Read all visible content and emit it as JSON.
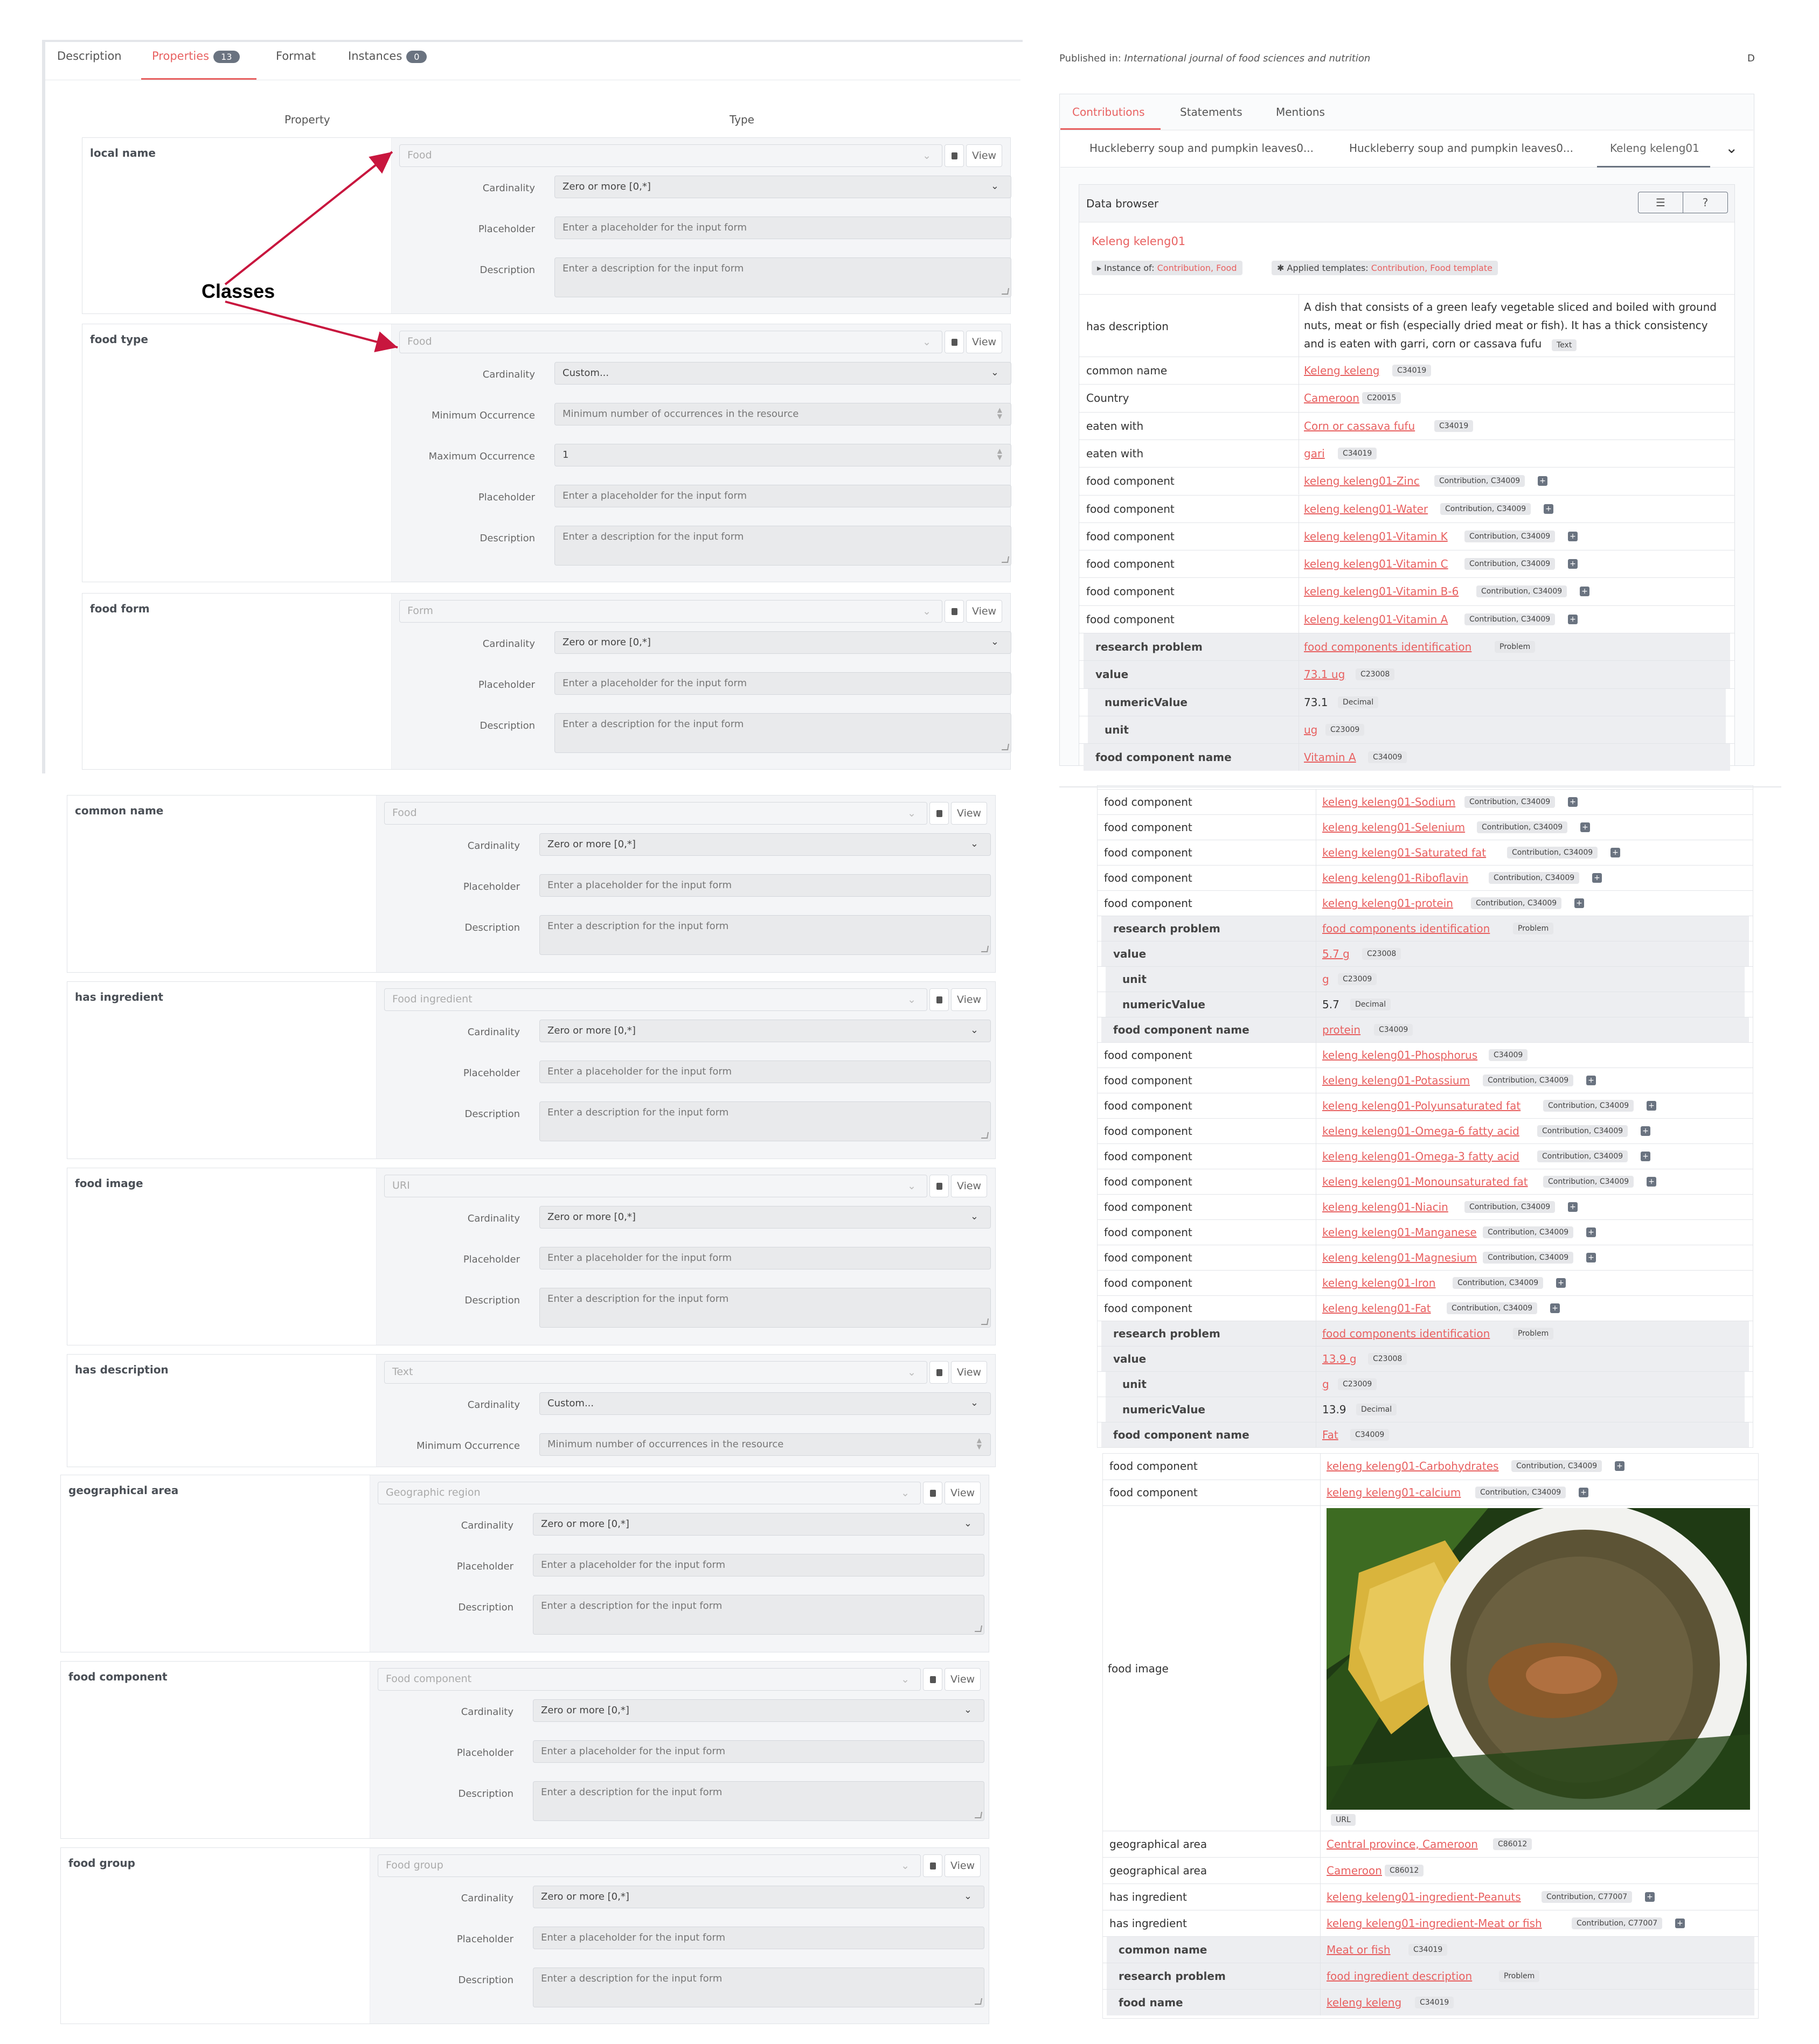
{
  "left": {
    "tabs": [
      {
        "label": "Description"
      },
      {
        "label": "Properties",
        "badge": "13"
      },
      {
        "label": "Format"
      },
      {
        "label": "Instances",
        "badge": "0"
      }
    ],
    "col_property": "Property",
    "col_type": "Type",
    "annotation": "Classes",
    "labels": {
      "cardinality": "Cardinality",
      "placeholder": "Placeholder",
      "description": "Description",
      "min": "Minimum Occurrence",
      "max": "Maximum Occurrence",
      "view": "View",
      "placeholder_hint": "Enter a placeholder for the input form",
      "description_hint": "Enter a description for the input form",
      "min_hint": "Minimum number of occurrences in the resource"
    },
    "properties": [
      {
        "name": "local name",
        "type": "Food",
        "cardinality": "Zero or more [0,*]"
      },
      {
        "name": "food type",
        "type": "Food",
        "cardinality": "Custom...",
        "max_value": "1"
      },
      {
        "name": "food form",
        "type": "Form",
        "cardinality": "Zero or more [0,*]"
      },
      {
        "name": "common name",
        "type": "Food",
        "cardinality": "Zero or more [0,*]"
      },
      {
        "name": "has ingredient",
        "type": "Food ingredient",
        "cardinality": "Zero or more [0,*]"
      },
      {
        "name": "food image",
        "type": "URI",
        "cardinality": "Zero or more [0,*]"
      },
      {
        "name": "has description",
        "type": "Text",
        "cardinality": "Custom..."
      },
      {
        "name": "geographical area",
        "type": "Geographic region",
        "cardinality": "Zero or more [0,*]"
      },
      {
        "name": "food component",
        "type": "Food component",
        "cardinality": "Zero or more [0,*]"
      },
      {
        "name": "food group",
        "type": "Food group",
        "cardinality": "Zero or more [0,*]"
      }
    ]
  },
  "right": {
    "published_label": "Published in:",
    "published_venue": "International journal of food sciences and nutrition",
    "top_tabs": [
      "Contributions",
      "Statements",
      "Mentions"
    ],
    "contrib_tabs": [
      "Huckleberry soup and pumpkin leaves0...",
      "Huckleberry soup and pumpkin leaves0...",
      "Keleng keleng01"
    ],
    "data_browser": "Data browser",
    "resource_title": "Keleng keleng01",
    "instance_of_label": "Instance of:",
    "instance_of_value": "Contribution, Food",
    "templates_label": "Applied templates:",
    "templates_value": "Contribution, Food template",
    "has_description": "has description",
    "description_text_1": "A dish that consists of a green leafy vegetable sliced and boiled with ground",
    "description_text_2": "nuts, meat or fish (especially dried meat or fish). It has a thick consistency",
    "description_text_3": "and is eaten with garri, corn or cassava fufu",
    "text_badge": "Text",
    "block1": [
      {
        "p": "common name",
        "v": "Keleng keleng",
        "t": "C34019"
      },
      {
        "p": "Country",
        "v": "Cameroon",
        "t": "C20015"
      },
      {
        "p": "eaten with",
        "v": "Corn or cassava fufu",
        "t": "C34019"
      },
      {
        "p": "eaten with",
        "v": "gari",
        "t": "C34019"
      },
      {
        "p": "food component",
        "v": "keleng keleng01-Zinc",
        "t": "Contribution, C34009"
      },
      {
        "p": "food component",
        "v": "keleng keleng01-Water",
        "t": "Contribution, C34009"
      },
      {
        "p": "food component",
        "v": "keleng keleng01-Vitamin K",
        "t": "Contribution, C34009"
      },
      {
        "p": "food component",
        "v": "keleng keleng01-Vitamin C",
        "t": "Contribution, C34009"
      },
      {
        "p": "food component",
        "v": "keleng keleng01-Vitamin B-6",
        "t": "Contribution, C34009"
      },
      {
        "p": "food component",
        "v": "keleng keleng01-Vitamin A",
        "t": "Contribution, C34009"
      }
    ],
    "block1_sub": [
      {
        "p": "research problem",
        "v": "food components identification",
        "t": "Problem",
        "lvl": 1
      },
      {
        "p": "value",
        "v": "73.1 ug",
        "t": "C23008",
        "lvl": 1
      },
      {
        "p": "numericValue",
        "plain": "73.1",
        "t": "Decimal",
        "lvl": 2
      },
      {
        "p": "unit",
        "v": "ug",
        "t": "C23009",
        "lvl": 2
      },
      {
        "p": "food component name",
        "v": "Vitamin A",
        "t": "C34009",
        "lvl": 1
      }
    ],
    "block2": [
      {
        "p": "food component",
        "v": "keleng keleng01-Sodium",
        "t": "Contribution, C34009"
      },
      {
        "p": "food component",
        "v": "keleng keleng01-Selenium",
        "t": "Contribution, C34009"
      },
      {
        "p": "food component",
        "v": "keleng keleng01-Saturated fat",
        "t": "Contribution, C34009"
      },
      {
        "p": "food component",
        "v": "keleng keleng01-Riboflavin",
        "t": "Contribution, C34009"
      },
      {
        "p": "food component",
        "v": "keleng keleng01-protein",
        "t": "Contribution, C34009"
      }
    ],
    "block2_sub": [
      {
        "p": "research problem",
        "v": "food components identification",
        "t": "Problem",
        "lvl": 1
      },
      {
        "p": "value",
        "v": "5.7 g",
        "t": "C23008",
        "lvl": 1
      },
      {
        "p": "unit",
        "v": "g",
        "t": "C23009",
        "lvl": 2
      },
      {
        "p": "numericValue",
        "plain": "5.7",
        "t": "Decimal",
        "lvl": 2
      },
      {
        "p": "food component name",
        "v": "protein",
        "t": "C34009",
        "lvl": 1
      }
    ],
    "block3": [
      {
        "p": "food component",
        "v": "keleng keleng01-Phosphorus",
        "t": "C34009"
      },
      {
        "p": "food component",
        "v": "keleng keleng01-Potassium",
        "t": "Contribution, C34009"
      },
      {
        "p": "food component",
        "v": "keleng keleng01-Polyunsaturated fat",
        "t": "Contribution, C34009"
      },
      {
        "p": "food component",
        "v": "keleng keleng01-Omega-6 fatty acid",
        "t": "Contribution, C34009"
      },
      {
        "p": "food component",
        "v": "keleng keleng01-Omega-3 fatty acid",
        "t": "Contribution, C34009"
      },
      {
        "p": "food component",
        "v": "keleng keleng01-Monounsaturated fat",
        "t": "Contribution, C34009"
      },
      {
        "p": "food component",
        "v": "keleng keleng01-Niacin",
        "t": "Contribution, C34009"
      },
      {
        "p": "food component",
        "v": "keleng keleng01-Manganese",
        "t": "Contribution, C34009"
      },
      {
        "p": "food component",
        "v": "keleng keleng01-Magnesium",
        "t": "Contribution, C34009"
      },
      {
        "p": "food component",
        "v": "keleng keleng01-Iron",
        "t": "Contribution, C34009"
      },
      {
        "p": "food component",
        "v": "keleng keleng01-Fat",
        "t": "Contribution, C34009"
      }
    ],
    "block3_sub": [
      {
        "p": "research problem",
        "v": "food components identification",
        "t": "Problem",
        "lvl": 1
      },
      {
        "p": "value",
        "v": "13.9 g",
        "t": "C23008",
        "lvl": 1
      },
      {
        "p": "unit",
        "v": "g",
        "t": "C23009",
        "lvl": 2
      },
      {
        "p": "numericValue",
        "plain": "13.9",
        "t": "Decimal",
        "lvl": 2
      },
      {
        "p": "food component name",
        "v": "Fat",
        "t": "C34009",
        "lvl": 1
      }
    ],
    "block4": [
      {
        "p": "food component",
        "v": "keleng keleng01-Carbohydrates",
        "t": "Contribution, C34009"
      },
      {
        "p": "food component",
        "v": "keleng keleng01-calcium",
        "t": "Contribution, C34009"
      }
    ],
    "food_image": "food image",
    "url_badge": "URL",
    "block5": [
      {
        "p": "geographical area",
        "v": "Central province, Cameroon",
        "t": "C86012"
      },
      {
        "p": "geographical area",
        "v": "Cameroon",
        "t": "C86012"
      },
      {
        "p": "has ingredient",
        "v": "keleng keleng01-ingredient-Peanuts",
        "t": "Contribution, C77007"
      },
      {
        "p": "has ingredient",
        "v": "keleng keleng01-ingredient-Meat or fish",
        "t": "Contribution, C77007"
      }
    ],
    "block5_sub": [
      {
        "p": "common name",
        "v": "Meat or fish",
        "t": "C34019",
        "lvl": 1
      },
      {
        "p": "research problem",
        "v": "food ingredient description",
        "t": "Problem",
        "lvl": 1
      },
      {
        "p": "food name",
        "v": "keleng keleng",
        "t": "C34019",
        "lvl": 1
      }
    ]
  }
}
